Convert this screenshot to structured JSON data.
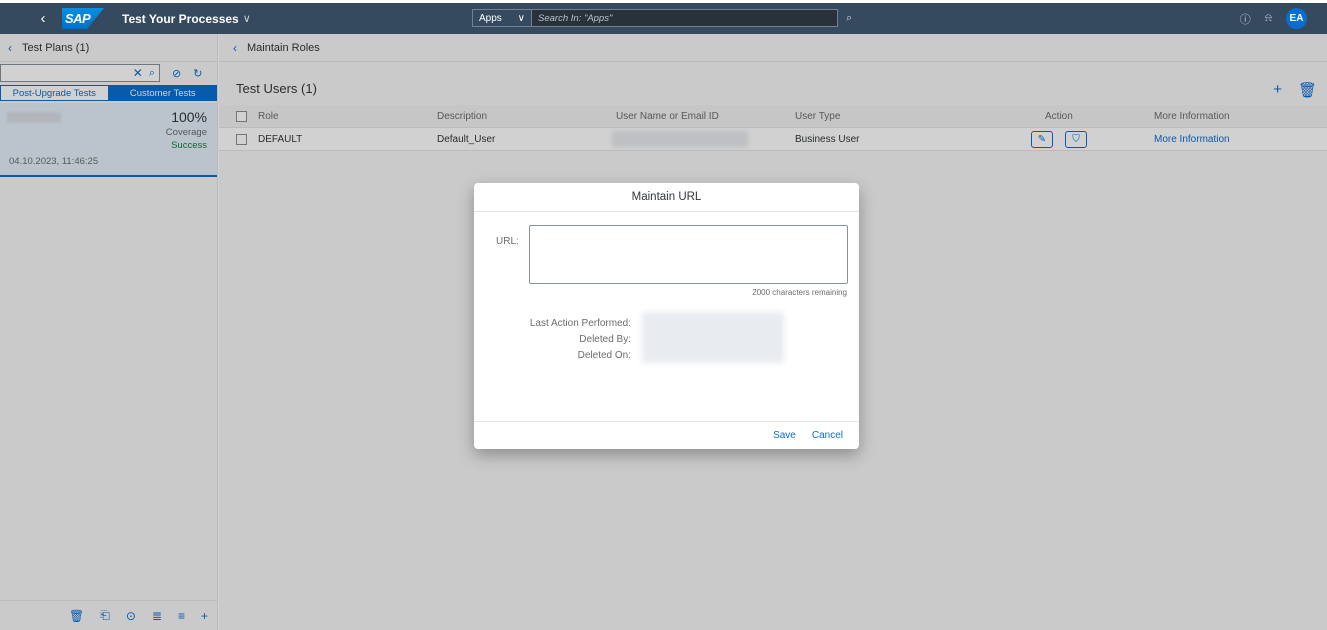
{
  "shell": {
    "logo": "SAP",
    "title": "Test Your Processes",
    "apps_label": "Apps",
    "search_placeholder": "Search In: \"Apps\"",
    "avatar_initials": "EA"
  },
  "left": {
    "header": "Test Plans (1)",
    "tabs": [
      "Post-Upgrade Tests",
      "Customer Tests"
    ],
    "active_tab": "Customer Tests",
    "plan": {
      "coverage_value": "100%",
      "coverage_label": "Coverage",
      "status": "Success",
      "datetime": "04.10.2023, 11:46:25"
    }
  },
  "page": {
    "header": "Maintain Roles",
    "table_title": "Test Users (1)",
    "columns": [
      "Role",
      "Description",
      "User Name or Email ID",
      "User Type",
      "Action",
      "More Information"
    ],
    "rows": [
      {
        "role": "DEFAULT",
        "description": "Default_User",
        "user_type": "Business User",
        "more": "More Information"
      }
    ]
  },
  "dialog": {
    "title": "Maintain URL",
    "url_label": "URL:",
    "url_value": "",
    "counter": "2000 characters remaining",
    "last_action_label": "Last Action Performed:",
    "deleted_by_label": "Deleted By:",
    "deleted_on_label": "Deleted On:",
    "save": "Save",
    "cancel": "Cancel"
  },
  "colors": {
    "shell_bg": "#354a5f",
    "accent": "#0a6ed1",
    "success": "#107e3e"
  }
}
